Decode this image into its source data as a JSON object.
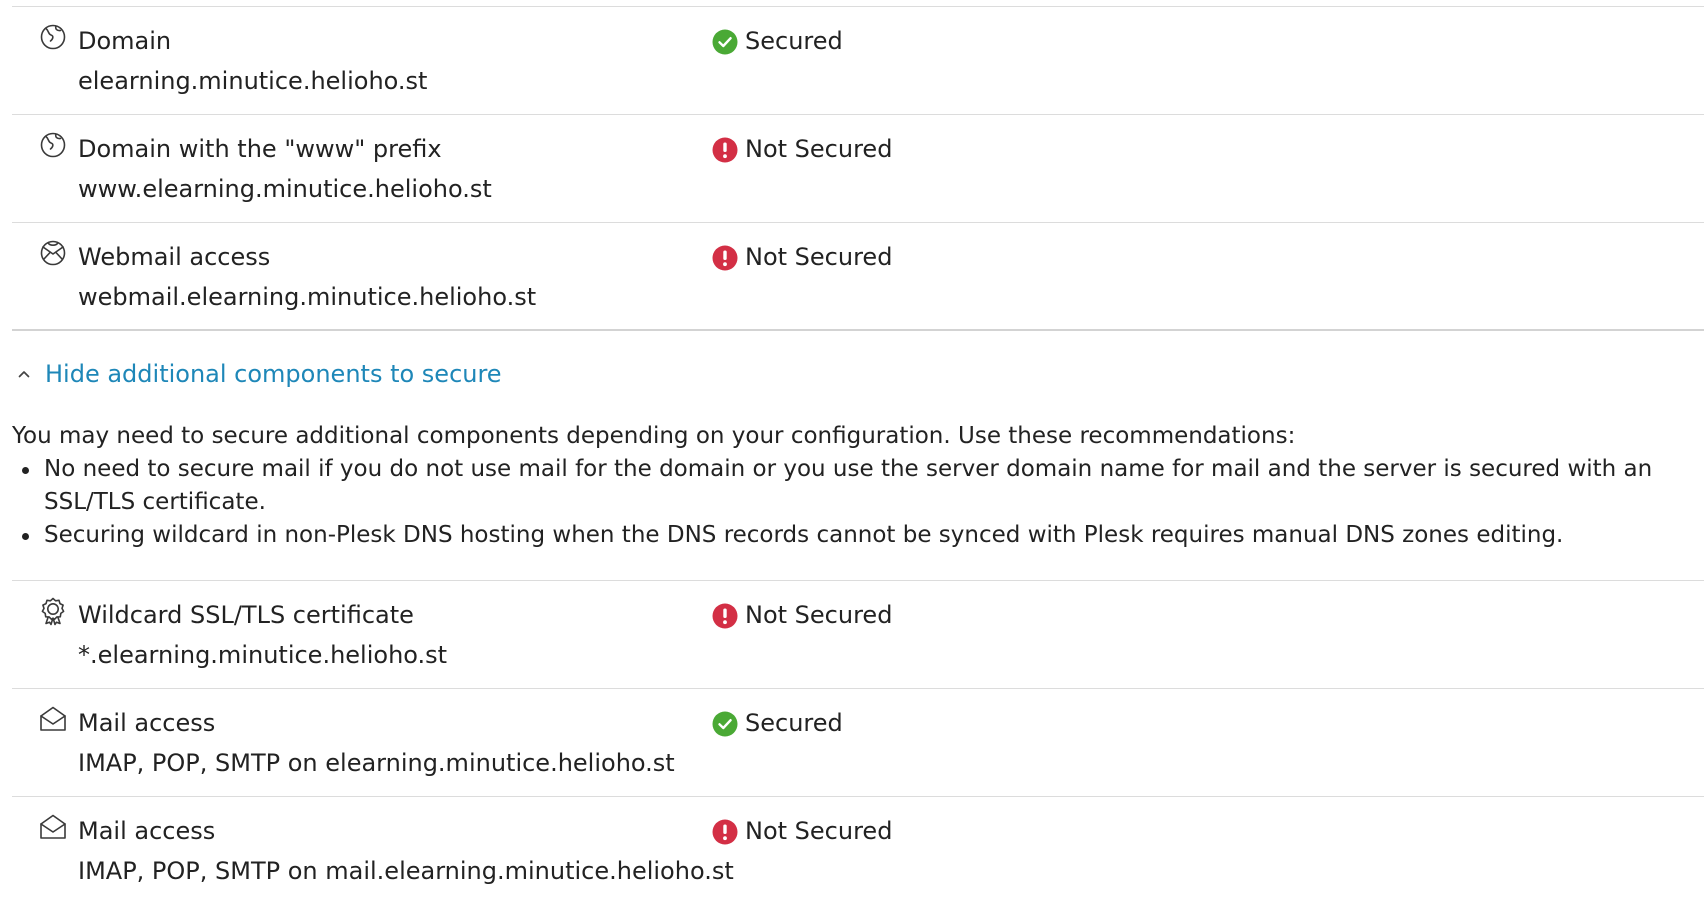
{
  "components": [
    {
      "icon": "globe-icon",
      "title": "Domain",
      "subtitle": "elearning.minutice.helioho.st",
      "status": "Secured",
      "status_icon": "check-circle-icon"
    },
    {
      "icon": "globe-icon",
      "title": "Domain with the \"www\" prefix",
      "subtitle": "www.elearning.minutice.helioho.st",
      "status": "Not Secured",
      "status_icon": "exclamation-circle-icon"
    },
    {
      "icon": "webmail-globe-icon",
      "title": "Webmail access",
      "subtitle": "webmail.elearning.minutice.helioho.st",
      "status": "Not Secured",
      "status_icon": "exclamation-circle-icon"
    }
  ],
  "toggle": {
    "label": "Hide additional components to secure",
    "icon": "chevron-up-icon"
  },
  "recommendations": {
    "intro": "You may need to secure additional components depending on your configuration. Use these recommendations:",
    "items": [
      "No need to secure mail if you do not use mail for the domain or you use the server domain name for mail and the server is secured with an SSL/TLS certificate.",
      "Securing wildcard in non-Plesk DNS hosting when the DNS records cannot be synced with Plesk requires manual DNS zones editing."
    ]
  },
  "additional_components": [
    {
      "icon": "certificate-badge-icon",
      "title": "Wildcard SSL/TLS certificate",
      "subtitle": "*.elearning.minutice.helioho.st",
      "status": "Not Secured",
      "status_icon": "exclamation-circle-icon"
    },
    {
      "icon": "envelope-icon",
      "title": "Mail access",
      "subtitle": "IMAP, POP, SMTP on elearning.minutice.helioho.st",
      "status": "Secured",
      "status_icon": "check-circle-icon"
    },
    {
      "icon": "envelope-icon",
      "title": "Mail access",
      "subtitle": "IMAP, POP, SMTP on mail.elearning.minutice.helioho.st",
      "status": "Not Secured",
      "status_icon": "exclamation-circle-icon"
    }
  ],
  "colors": {
    "secured": "#4aa935",
    "not_secured": "#d32f45",
    "link": "#1e87b8",
    "text": "#222222",
    "icon_stroke": "#3a3a3a"
  }
}
